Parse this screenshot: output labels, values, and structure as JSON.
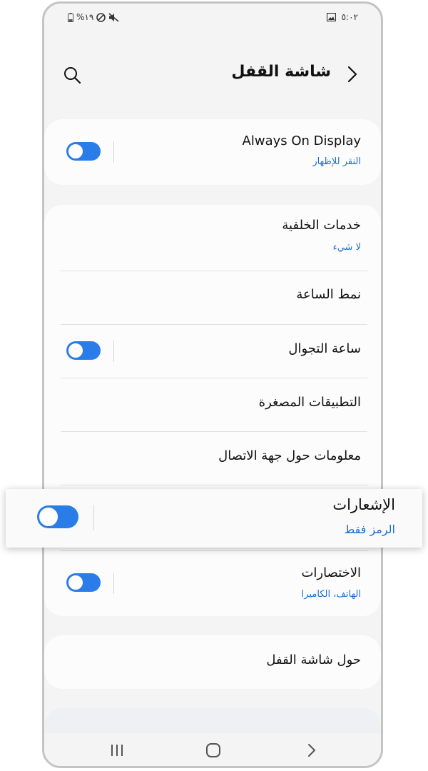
{
  "status_bar": {
    "time": "٥:٠٢",
    "battery": "%١٩"
  },
  "header": {
    "title": "شاشة القفل"
  },
  "settings": [
    {
      "title": "Always On Display",
      "subtitle": "النقر للإظهار",
      "toggle_on": true
    },
    {
      "title": "خدمات الخلفية",
      "subtitle": "لا شيء"
    },
    {
      "title": "نمط الساعة"
    },
    {
      "title": "ساعة التجوال",
      "toggle_on": true
    },
    {
      "title": "التطبيقات المصغرة"
    },
    {
      "title": "معلومات حول جهة الاتصال"
    },
    {
      "title": "الإشعارات",
      "subtitle": "الرمز فقط",
      "toggle_on": true
    },
    {
      "title": "الاختصارات",
      "subtitle": "الهاتف، الكاميرا",
      "toggle_on": true
    },
    {
      "title": "حول شاشة القفل"
    }
  ],
  "colors": {
    "accent": "#2a7de8",
    "subtitle": "#1c6fd0",
    "background": "#f4f4f4"
  }
}
